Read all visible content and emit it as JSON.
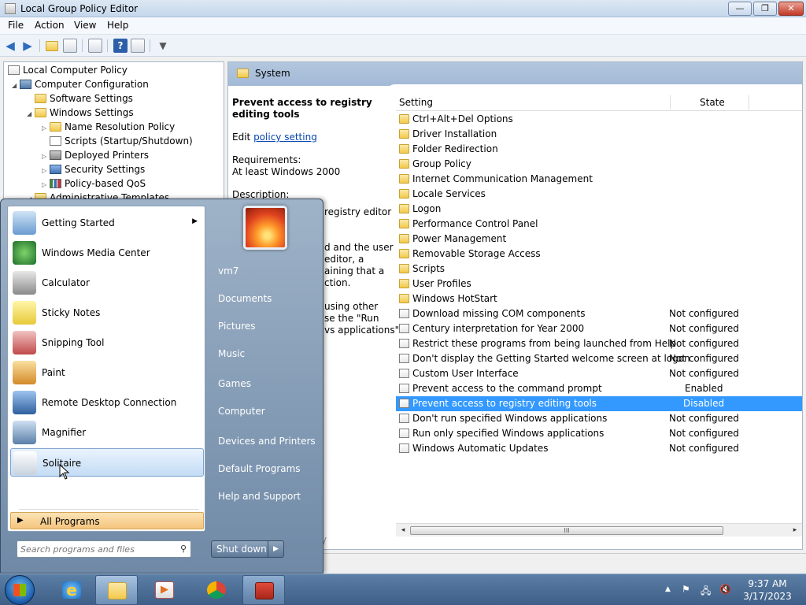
{
  "window": {
    "title": "Local Group Policy Editor",
    "buttons": {
      "minimize": "—",
      "maximize": "❐",
      "close": "✕"
    }
  },
  "menubar": {
    "items": [
      "File",
      "Action",
      "View",
      "Help"
    ]
  },
  "toolbar": {
    "icons": [
      "back-arrow-icon",
      "forward-arrow-icon",
      "up-folder-icon",
      "show-hide-tree-icon",
      "export-list-icon",
      "help-icon",
      "properties-icon",
      "filter-icon"
    ]
  },
  "tree": {
    "items": [
      {
        "label": "Local Computer Policy",
        "icon": "policy-icon"
      },
      {
        "label": "Computer Configuration",
        "icon": "computer-icon",
        "expander": "◢"
      },
      {
        "label": "Software Settings",
        "icon": "folder-icon"
      },
      {
        "label": "Windows Settings",
        "icon": "folder-icon",
        "expander": "◢"
      },
      {
        "label": "Name Resolution Policy",
        "icon": "folder-icon",
        "expander": "▷"
      },
      {
        "label": "Scripts (Startup/Shutdown)",
        "icon": "script-icon"
      },
      {
        "label": "Deployed Printers",
        "icon": "printer-icon",
        "expander": "▷"
      },
      {
        "label": "Security Settings",
        "icon": "shield-icon",
        "expander": "▷"
      },
      {
        "label": "Policy-based QoS",
        "icon": "qos-chart-icon",
        "expander": "▷"
      },
      {
        "label": "Administrative Templates",
        "icon": "folder-icon",
        "expander": "◢"
      }
    ]
  },
  "right_panel": {
    "header": "System",
    "description": {
      "title": "Prevent access to registry editing tools",
      "edit_prefix": "Edit ",
      "edit_link": "policy setting",
      "requirements_label": "Requirements:",
      "requirements_value": "At least Windows 2000",
      "description_label": "Description:",
      "fragments": [
        "registry editor",
        "d and the user",
        "editor, a",
        "aining that a",
        "ction.",
        "using other",
        "se the \"Run",
        "vs applications\""
      ]
    },
    "columns": {
      "setting": "Setting",
      "state": "State"
    },
    "rows": [
      {
        "name": "Ctrl+Alt+Del Options",
        "type": "folder",
        "state": ""
      },
      {
        "name": "Driver Installation",
        "type": "folder",
        "state": ""
      },
      {
        "name": "Folder Redirection",
        "type": "folder",
        "state": ""
      },
      {
        "name": "Group Policy",
        "type": "folder",
        "state": ""
      },
      {
        "name": "Internet Communication Management",
        "type": "folder",
        "state": ""
      },
      {
        "name": "Locale Services",
        "type": "folder",
        "state": ""
      },
      {
        "name": "Logon",
        "type": "folder",
        "state": ""
      },
      {
        "name": "Performance Control Panel",
        "type": "folder",
        "state": ""
      },
      {
        "name": "Power Management",
        "type": "folder",
        "state": ""
      },
      {
        "name": "Removable Storage Access",
        "type": "folder",
        "state": ""
      },
      {
        "name": "Scripts",
        "type": "folder",
        "state": ""
      },
      {
        "name": "User Profiles",
        "type": "folder",
        "state": ""
      },
      {
        "name": "Windows HotStart",
        "type": "folder",
        "state": ""
      },
      {
        "name": "Download missing COM components",
        "type": "policy",
        "state": "Not configured"
      },
      {
        "name": "Century interpretation for Year 2000",
        "type": "policy",
        "state": "Not configured"
      },
      {
        "name": "Restrict these programs from being launched from Help",
        "type": "policy",
        "state": "Not configured"
      },
      {
        "name": "Don't display the Getting Started welcome screen at logon",
        "type": "policy",
        "state": "Not configured"
      },
      {
        "name": "Custom User Interface",
        "type": "policy",
        "state": "Not configured"
      },
      {
        "name": "Prevent access to the command prompt",
        "type": "policy",
        "state": "Enabled"
      },
      {
        "name": "Prevent access to registry editing tools",
        "type": "policy",
        "state": "Disabled",
        "selected": true
      },
      {
        "name": "Don't run specified Windows applications",
        "type": "policy",
        "state": "Not configured"
      },
      {
        "name": "Run only specified Windows applications",
        "type": "policy",
        "state": "Not configured"
      },
      {
        "name": "Windows Automatic Updates",
        "type": "policy",
        "state": "Not configured"
      }
    ],
    "scrollbar": {
      "left": "◂",
      "grip": "III",
      "right": "▸"
    }
  },
  "start_menu": {
    "programs": [
      {
        "label": "Getting Started",
        "icon": "getting-started-icon",
        "submenu": "▶"
      },
      {
        "label": "Windows Media Center",
        "icon": "windows-media-center-icon"
      },
      {
        "label": "Calculator",
        "icon": "calculator-icon"
      },
      {
        "label": "Sticky Notes",
        "icon": "sticky-notes-icon"
      },
      {
        "label": "Snipping Tool",
        "icon": "snipping-tool-icon"
      },
      {
        "label": "Paint",
        "icon": "paint-icon"
      },
      {
        "label": "Remote Desktop Connection",
        "icon": "remote-desktop-icon"
      },
      {
        "label": "Magnifier",
        "icon": "magnifier-icon"
      },
      {
        "label": "Solitaire",
        "icon": "solitaire-icon",
        "hover": true
      }
    ],
    "all_programs": {
      "arrow": "▶",
      "label": "All Programs"
    },
    "search": {
      "placeholder": "Search programs and files",
      "icon": "⚲"
    },
    "user_picture": "user-picture-flower",
    "right_items": [
      "vm7",
      "Documents",
      "Pictures",
      "Music",
      "Games",
      "Computer",
      "Devices and Printers",
      "Default Programs",
      "Help and Support"
    ],
    "shutdown": {
      "label": "Shut down",
      "arrow": "▶"
    }
  },
  "taskbar": {
    "start": "start-orb-icon",
    "apps": [
      {
        "name": "internet-explorer-icon",
        "state": "pinned",
        "glyph": "e"
      },
      {
        "name": "windows-explorer-icon",
        "state": "active"
      },
      {
        "name": "media-player-icon",
        "state": "pinned",
        "glyph": "▶"
      },
      {
        "name": "chrome-icon",
        "state": "pinned"
      },
      {
        "name": "toolbox-app-icon",
        "state": "running"
      }
    ],
    "tray": {
      "show_hidden": "▲",
      "flag": "⚑",
      "network": "🖧",
      "volume_muted": "🔇"
    },
    "clock": {
      "time": "9:37 AM",
      "date": "3/17/2023"
    }
  },
  "colors": {
    "selection": "#3399ff",
    "link": "#0645ad",
    "taskbar": "#3e5f87"
  }
}
